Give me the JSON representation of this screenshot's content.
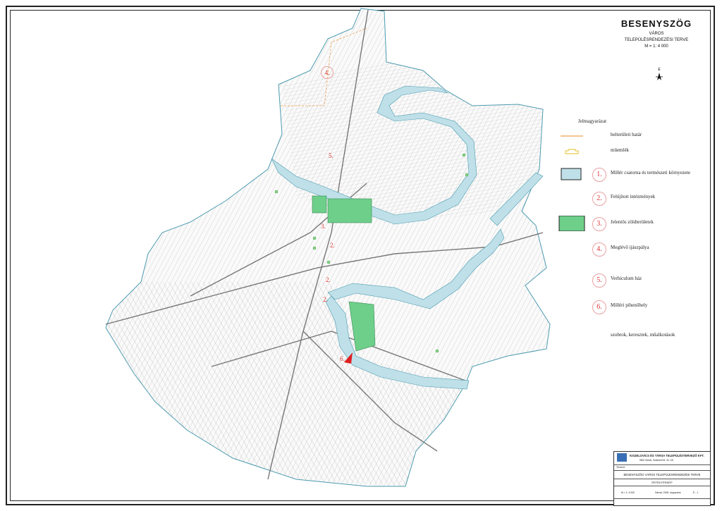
{
  "map": {
    "title": "BESENYSZÖG",
    "subtitle_1": "VÁROS",
    "subtitle_2": "TELEPÜLÉSRENDEZÉSI TERVE",
    "scale": "M = 1: 4 000",
    "north_letter": "É"
  },
  "legend": {
    "title": "Jelmagyarázat",
    "items": [
      {
        "num": "",
        "label": "belterületi határ",
        "symbol": "boundary-line"
      },
      {
        "num": "",
        "label": "műemlék",
        "symbol": "monument"
      },
      {
        "num": "1.",
        "label": "Millér csatorna és természeti környezete",
        "symbol": "water-area"
      },
      {
        "num": "2.",
        "label": "Felújított intézmények",
        "symbol": "none"
      },
      {
        "num": "3.",
        "label": "Jelentős zöldterületek",
        "symbol": "green-area"
      },
      {
        "num": "4.",
        "label": "Meglévő ijászpálya",
        "symbol": "none"
      },
      {
        "num": "5.",
        "label": "Verhiculum ház",
        "symbol": "none"
      },
      {
        "num": "6.",
        "label": "Milléri pihenőhely",
        "symbol": "none"
      },
      {
        "num": "",
        "label": "szobrok, keresztek, műalkotások",
        "symbol": "statue-dot"
      }
    ]
  },
  "map_labels": [
    "4.",
    "5.",
    "3.",
    "2.",
    "2.",
    "2.",
    "6."
  ],
  "stamp": {
    "firm": "KISZELOVICS ÉS TÁRSA TELEPÜLÉSTERVEZŐ KFT.",
    "address": "9600 Sárvár, Szatmári Kft. 33. 1/8",
    "project": "BESENYSZÖG VÁROS TELEPÜLÉSRENDEZÉSI TERVE",
    "sheet_name": "ÉRTÉKTÉRKÉP",
    "scale": "M = 1: 4 000",
    "date": "Sárvár, 2006. augusztus",
    "sheet_no": "É - 1",
    "prepared": "Tervező:"
  },
  "colors": {
    "water": "#bfe0e8",
    "green": "#6ecf8a",
    "boundary": "#f0b070",
    "lines": "#8a8a8a",
    "outline": "#4a9ab0",
    "legend_num": "#d33"
  }
}
